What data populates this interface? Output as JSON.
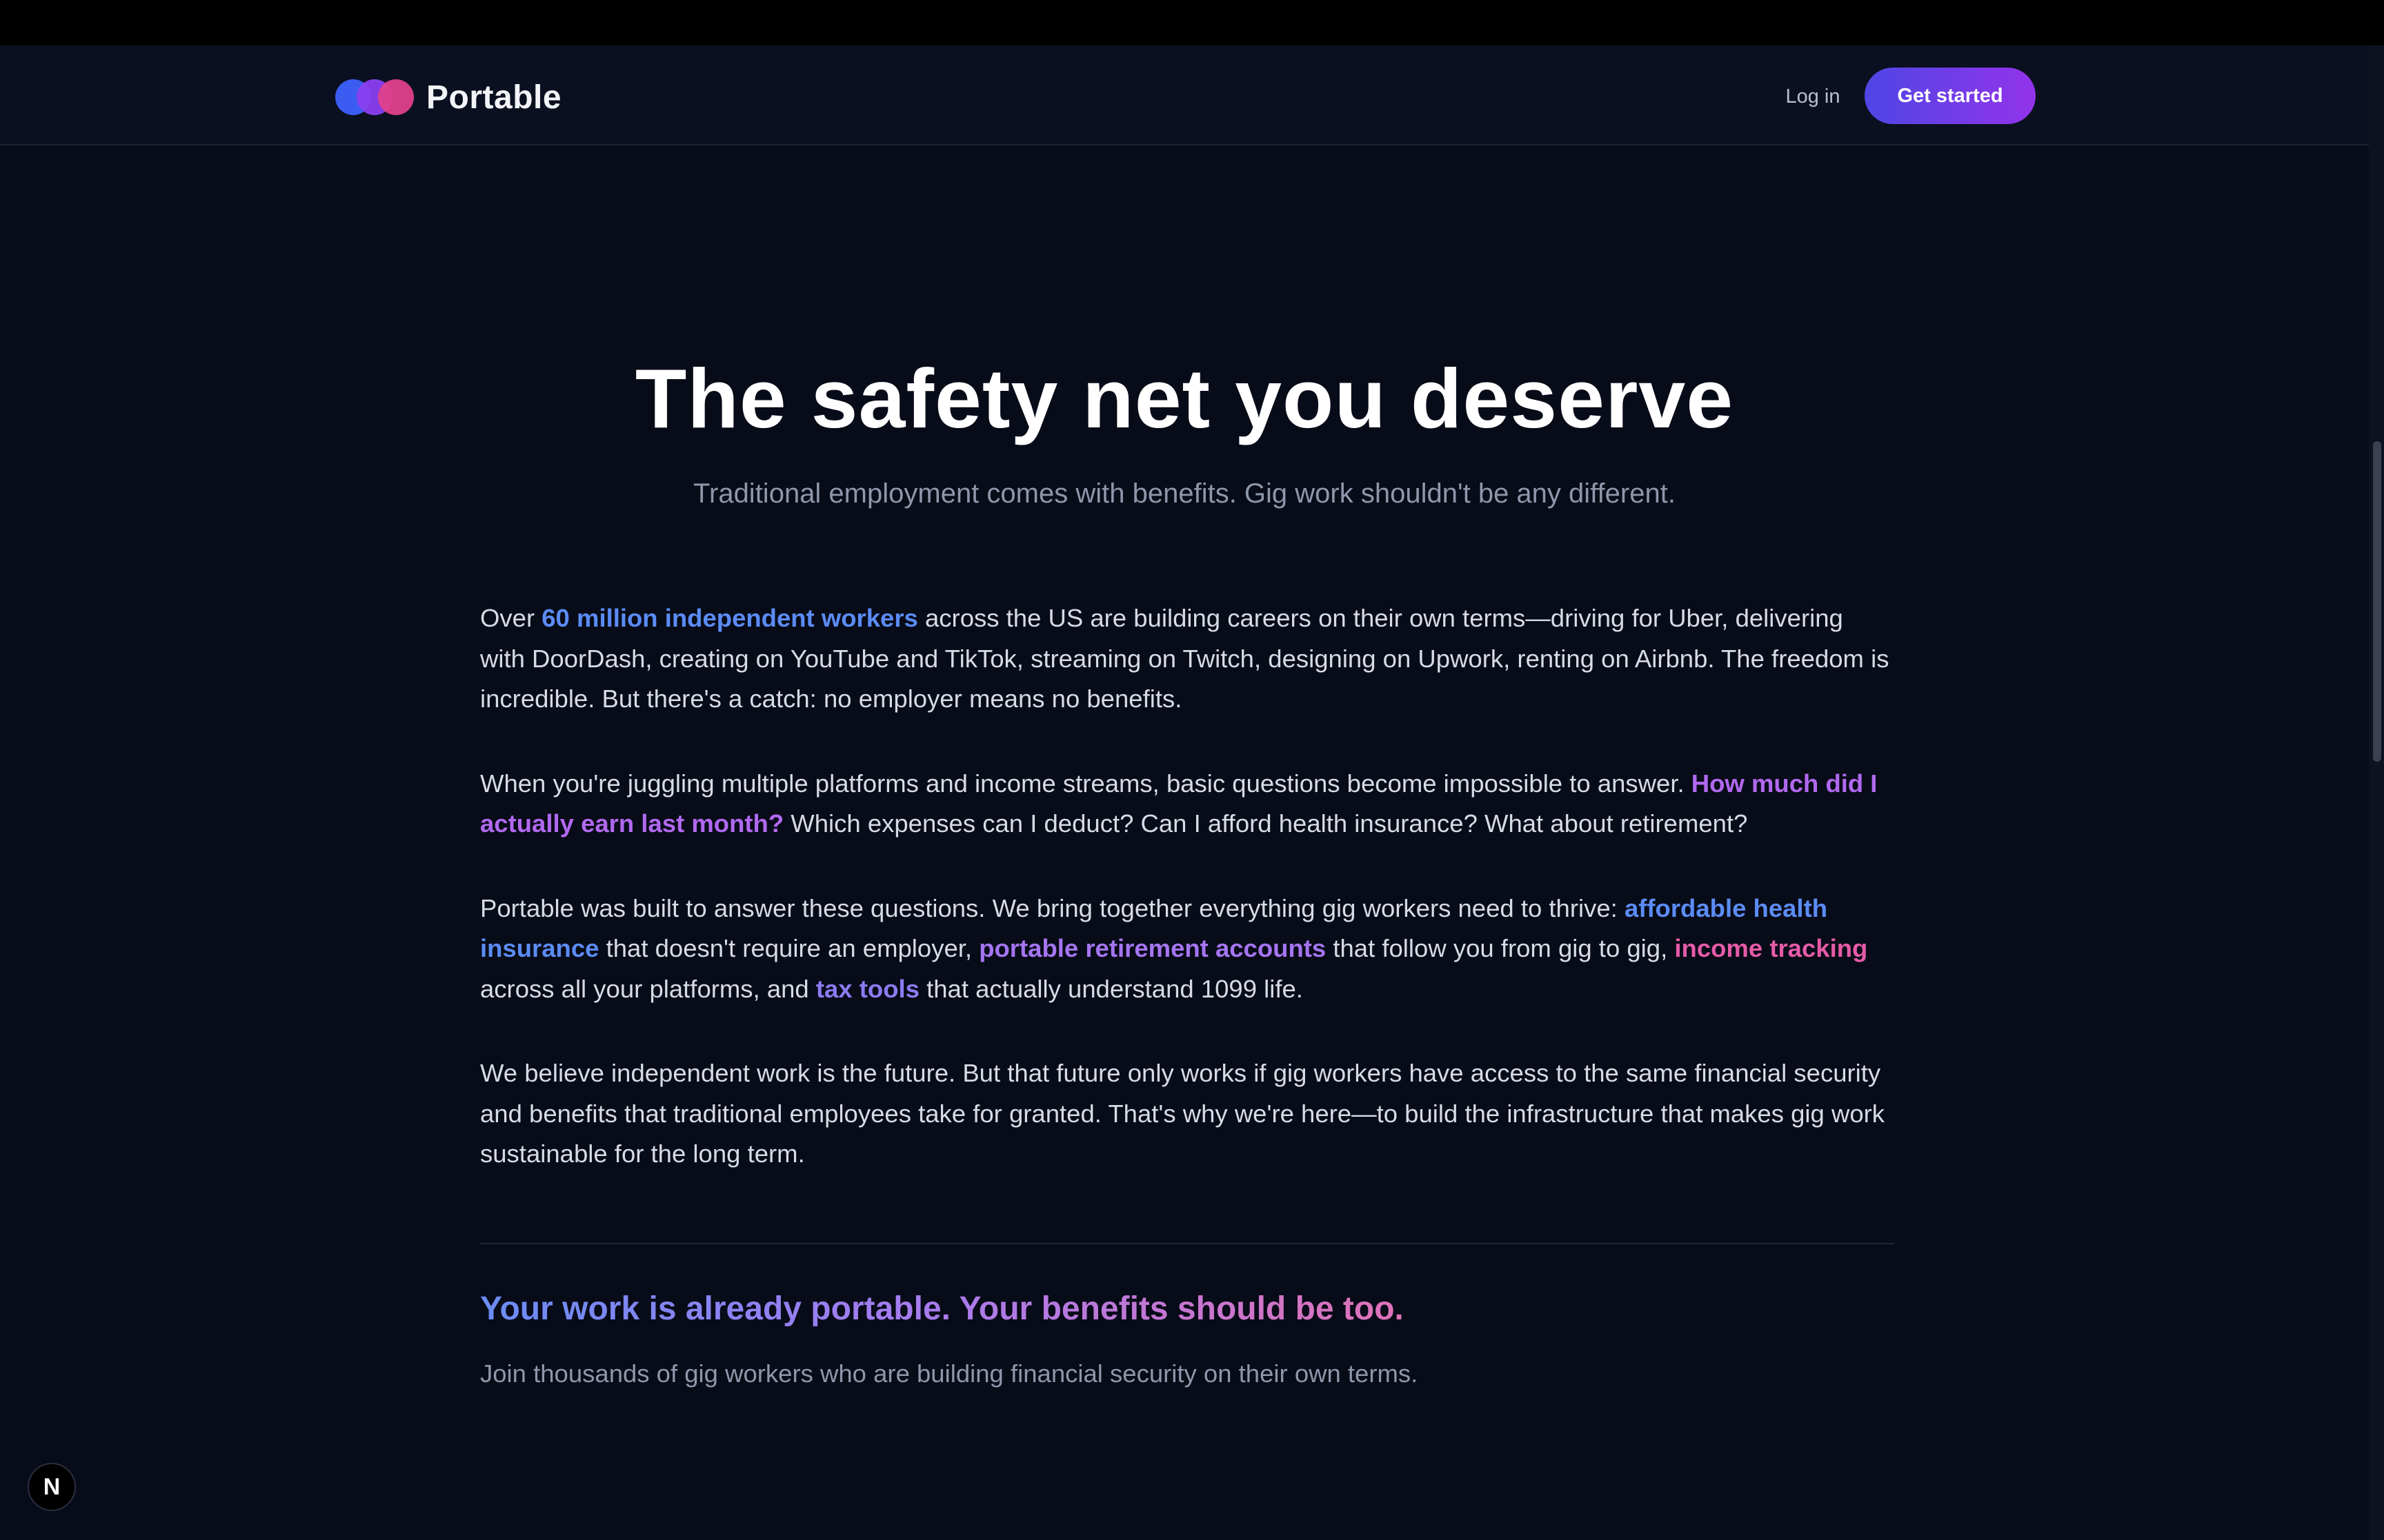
{
  "navbar": {
    "brand": "Portable",
    "login_label": "Log in",
    "cta_label": "Get started"
  },
  "hero": {
    "title": "The safety net you deserve",
    "subtitle": "Traditional employment comes with benefits. Gig work shouldn't be any different."
  },
  "paragraphs": {
    "p1": {
      "t1": "Over ",
      "h1": "60 million independent workers",
      "t2": " across the US are building careers on their own terms—driving for Uber, delivering with DoorDash, creating on YouTube and TikTok, streaming on Twitch, designing on Upwork, renting on Airbnb. The freedom is incredible. But there's a catch: no employer means no benefits."
    },
    "p2": {
      "t1": "When you're juggling multiple platforms and income streams, basic questions become impossible to answer. ",
      "h1": "How much did I actually earn last month?",
      "t2": " Which expenses can I deduct? Can I afford health insurance? What about retirement?"
    },
    "p3": {
      "t1": "Portable was built to answer these questions. We bring together everything gig workers need to thrive: ",
      "h1": "affordable health insurance",
      "t2": " that doesn't require an employer, ",
      "h2": "portable retirement accounts",
      "t3": " that follow you from gig to gig, ",
      "h3": "income tracking",
      "t4": " across all your platforms, and ",
      "h4": "tax tools",
      "t5": " that actually understand 1099 life."
    },
    "p4": {
      "t1": "We believe independent work is the future. But that future only works if gig workers have access to the same financial security and benefits that traditional employees take for granted. That's why we're here—to build the infrastructure that makes gig work sustainable for the long term."
    }
  },
  "closing": {
    "tagline": "Your work is already portable. Your benefits should be too.",
    "join_text": "Join thousands of gig workers who are building financial security on their own terms."
  },
  "badge": {
    "letter": "N"
  },
  "colors": {
    "background": "#080b18",
    "navbar": "#0b1020",
    "accent_blue": "#5b8cf5",
    "accent_purple": "#b169f0",
    "accent_pink": "#e55ba7",
    "cta_gradient_start": "#4f46e5",
    "cta_gradient_end": "#9333ea"
  }
}
